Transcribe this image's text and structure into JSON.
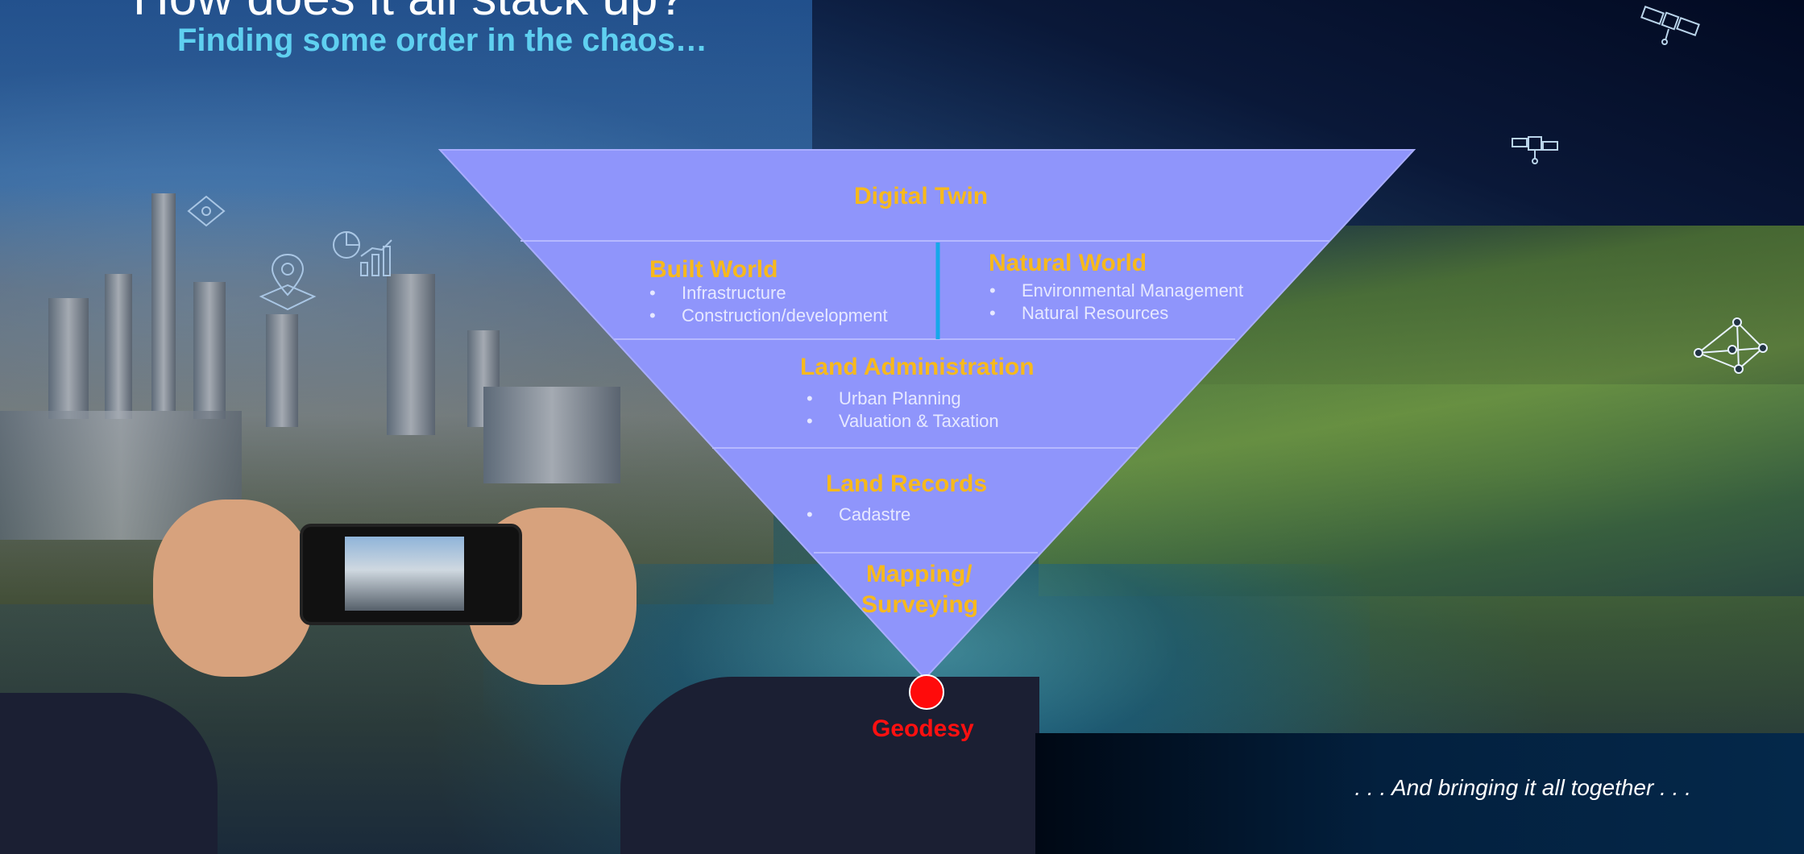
{
  "header": {
    "title": "How does it all stack up?",
    "subtitle": "Finding some order in the chaos…"
  },
  "pyramid": {
    "digital_twin": "Digital Twin",
    "built_world": {
      "heading": "Built World",
      "items": [
        "Infrastructure",
        "Construction/development"
      ]
    },
    "natural_world": {
      "heading": "Natural World",
      "items": [
        "Environmental Management",
        "Natural Resources"
      ]
    },
    "land_administration": {
      "heading": "Land Administration",
      "items": [
        "Urban Planning",
        "Valuation & Taxation"
      ]
    },
    "land_records": {
      "heading": "Land Records",
      "items": [
        "Cadastre"
      ]
    },
    "mapping": {
      "line1": "Mapping/",
      "line2": "Surveying"
    },
    "geodesy": "Geodesy"
  },
  "banner": {
    "text": ". . . And bringing it all together . . ."
  },
  "colors": {
    "pyramid_fill": "#8f95fb",
    "heading": "#f7b91c",
    "item_text": "#e6e8ff",
    "divider": "#16a8ea",
    "geodesy": "#ff0b0b",
    "subtitle": "#5fd0f0"
  },
  "icons": [
    "satellite-icon",
    "satellite-small-icon",
    "network-icon",
    "drone-icon",
    "location-pin-icon",
    "pie-chart-icon",
    "bar-chart-icon"
  ]
}
